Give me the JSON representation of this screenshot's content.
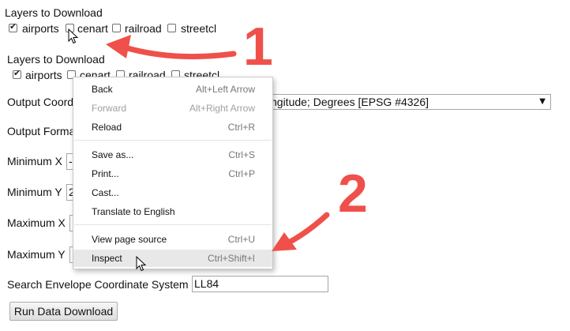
{
  "top_form": {
    "heading": "Layers to Download",
    "layers": [
      {
        "label": "airports",
        "checked": true
      },
      {
        "label": "cenart",
        "checked": false
      },
      {
        "label": "railroad",
        "checked": false
      },
      {
        "label": "streetcl",
        "checked": false
      }
    ]
  },
  "annotations": {
    "step1": "1",
    "step2": "2",
    "accent_color": "#f0504a"
  },
  "form": {
    "heading": "Layers to Download",
    "layers": [
      {
        "label": "airports",
        "checked": true
      },
      {
        "label": "cenart",
        "checked": false
      },
      {
        "label": "railroad",
        "checked": false
      },
      {
        "label": "streetcl",
        "checked": false
      }
    ],
    "output_coord_label": "Output Coord",
    "output_coord_value": "ngitude; Degrees [EPSG #4326]",
    "output_format_label": "Output Forma",
    "min_x_label": "Minimum X",
    "min_x_value": "-",
    "min_y_label": "Minimum Y",
    "min_y_value": "2",
    "max_x_label": "Maximum X",
    "max_y_label": "Maximum Y",
    "envelope_label": "Search Envelope Coordinate System",
    "envelope_value": "LL84",
    "run_button": "Run Data Download"
  },
  "context_menu": {
    "items": [
      {
        "label": "Back",
        "shortcut": "Alt+Left Arrow",
        "disabled": false
      },
      {
        "label": "Forward",
        "shortcut": "Alt+Right Arrow",
        "disabled": true
      },
      {
        "label": "Reload",
        "shortcut": "Ctrl+R",
        "disabled": false
      },
      {
        "label": "Save as...",
        "shortcut": "Ctrl+S",
        "disabled": false
      },
      {
        "label": "Print...",
        "shortcut": "Ctrl+P",
        "disabled": false
      },
      {
        "label": "Cast...",
        "shortcut": "",
        "disabled": false
      },
      {
        "label": "Translate to English",
        "shortcut": "",
        "disabled": false
      },
      {
        "label": "View page source",
        "shortcut": "Ctrl+U",
        "disabled": false
      },
      {
        "label": "Inspect",
        "shortcut": "Ctrl+Shift+I",
        "disabled": false,
        "highlighted": true
      }
    ]
  }
}
